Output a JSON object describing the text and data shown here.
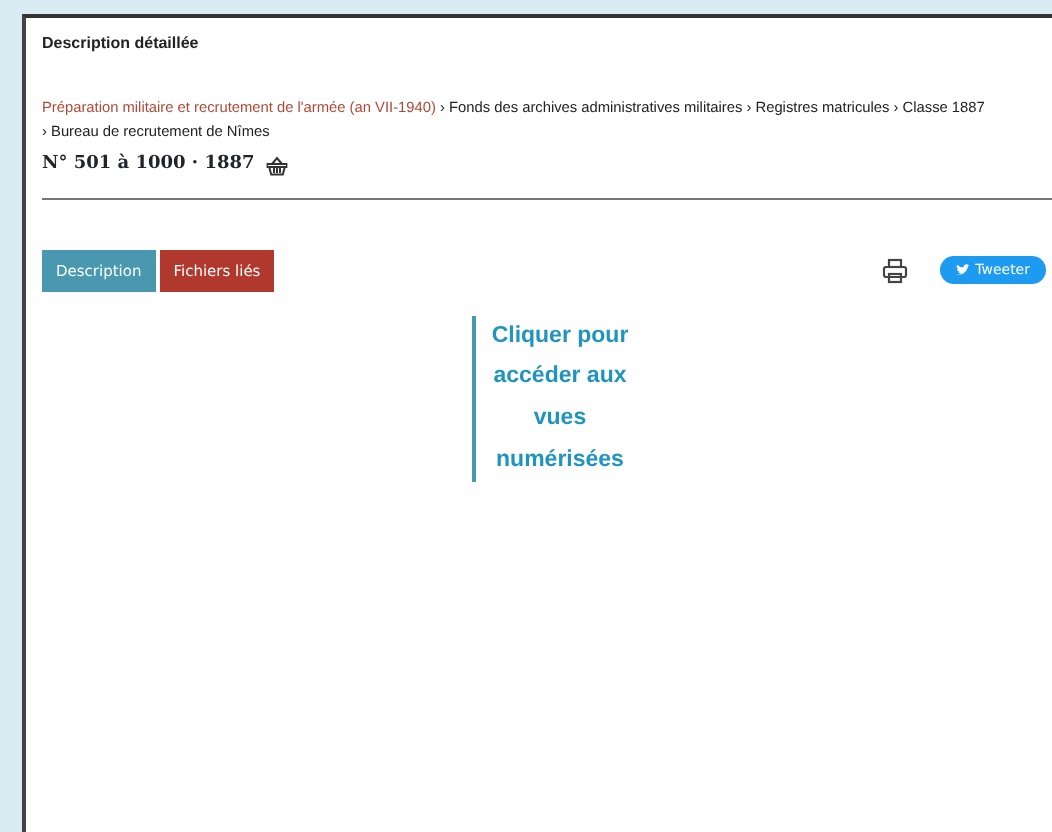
{
  "panel_title": "Description détaillée",
  "breadcrumb": [
    {
      "label": "Préparation militaire et recrutement de l'armée (an VII-1940)",
      "kind": "link"
    },
    {
      "label": "Fonds des archives administratives militaires",
      "kind": "text"
    },
    {
      "label": "Registres matricules",
      "kind": "text"
    },
    {
      "label": "Classe 1887",
      "kind": "text"
    },
    {
      "label": "Bureau de recrutement de Nîmes",
      "kind": "text"
    }
  ],
  "separator": "›",
  "record_title": "N° 501 à 1000 · 1887",
  "tabs": [
    {
      "label": "Description",
      "color": "#4a98b0"
    },
    {
      "label": "Fichiers liés",
      "color": "#b0382c"
    }
  ],
  "tweet_button": "Tweeter",
  "viewer_link": "Cliquer pour accéder aux vues numérisées"
}
